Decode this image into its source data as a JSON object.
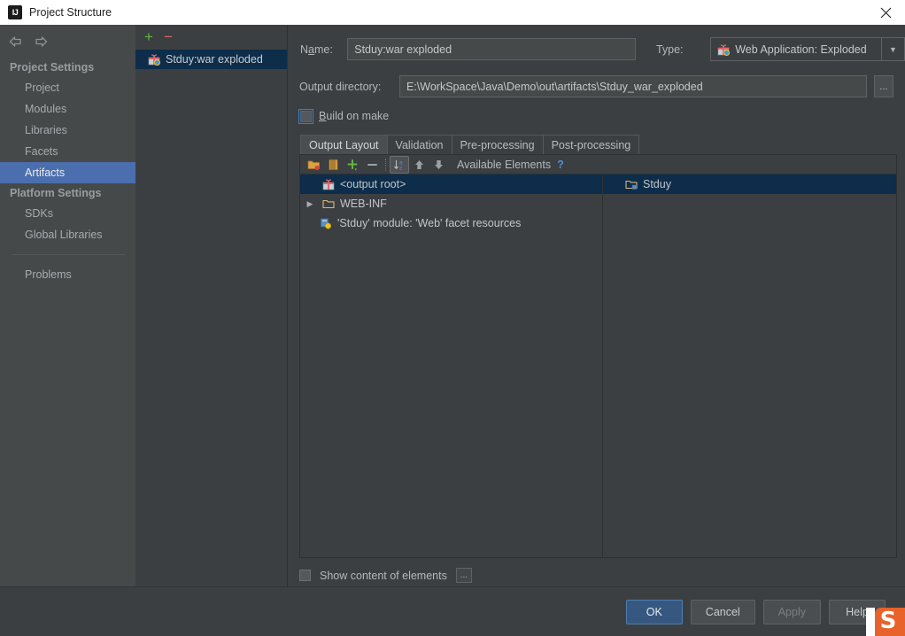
{
  "window": {
    "title": "Project Structure",
    "logo_icon": "intellij-idea-icon",
    "close_icon": "close-icon"
  },
  "sidebar": {
    "back_icon": "arrow-left-icon",
    "forward_icon": "arrow-right-icon",
    "groups": [
      {
        "label": "Project Settings",
        "items": [
          {
            "label": "Project",
            "selected": false
          },
          {
            "label": "Modules",
            "selected": false
          },
          {
            "label": "Libraries",
            "selected": false
          },
          {
            "label": "Facets",
            "selected": false
          },
          {
            "label": "Artifacts",
            "selected": true
          }
        ]
      },
      {
        "label": "Platform Settings",
        "items": [
          {
            "label": "SDKs",
            "selected": false
          },
          {
            "label": "Global Libraries",
            "selected": false
          }
        ]
      }
    ],
    "problems": {
      "label": "Problems"
    }
  },
  "artifact_list": {
    "add_label": "+",
    "remove_label": "−",
    "items": [
      {
        "label": "Stduy:war exploded",
        "icon": "artifact-icon",
        "selected": true
      }
    ]
  },
  "form": {
    "name_label": "Name:",
    "name_value": "Stduy:war exploded",
    "type_label": "Type:",
    "type_value": "Web Application: Exploded",
    "type_icon": "artifact-icon",
    "output_dir_label": "Output directory:",
    "output_dir_value": "E:\\WorkSpace\\Java\\Demo\\out\\artifacts\\Stduy_war_exploded",
    "browse_label": "...",
    "build_on_make_label": "Build on make",
    "build_on_make_checked": false
  },
  "tabs": [
    {
      "label": "Output Layout",
      "active": true
    },
    {
      "label": "Validation",
      "active": false
    },
    {
      "label": "Pre-processing",
      "active": false
    },
    {
      "label": "Post-processing",
      "active": false
    }
  ],
  "tree_toolbar": {
    "buttons": [
      {
        "name": "add-directory-icon",
        "pressed": false
      },
      {
        "name": "add-archive-icon",
        "pressed": false
      },
      {
        "name": "add-copy-icon",
        "pressed": false
      },
      {
        "name": "remove-icon",
        "pressed": false
      },
      {
        "name": "sort-alphabetically-icon",
        "pressed": true
      },
      {
        "name": "move-up-icon",
        "pressed": false
      },
      {
        "name": "move-down-icon",
        "pressed": false
      }
    ]
  },
  "available_elements": {
    "header": "Available Elements",
    "help_label": "?",
    "items": [
      {
        "label": "Stduy",
        "icon": "module-folder-icon",
        "selected": true
      }
    ]
  },
  "output_layout_tree": {
    "nodes": [
      {
        "label": "<output root>",
        "icon": "artifact-icon",
        "selected": true,
        "expandable": false,
        "indent": 0
      },
      {
        "label": "WEB-INF",
        "icon": "folder-icon",
        "selected": false,
        "expandable": true,
        "indent": 1
      },
      {
        "label": "'Stduy' module: 'Web' facet resources",
        "icon": "facet-resources-icon",
        "selected": false,
        "expandable": false,
        "indent": 2
      }
    ]
  },
  "footer": {
    "show_content_label": "Show content of elements",
    "show_content_checked": false,
    "more_label": "..."
  },
  "dialog_buttons": [
    {
      "label": "OK",
      "style": "default",
      "enabled": true
    },
    {
      "label": "Cancel",
      "style": "normal",
      "enabled": true
    },
    {
      "label": "Apply",
      "style": "normal",
      "enabled": false
    },
    {
      "label": "Help",
      "style": "normal",
      "enabled": true
    }
  ],
  "corner_badge": {
    "glyph": "S",
    "name": "sogou-input-badge"
  },
  "colors": {
    "accent_selection": "#4b6eaf",
    "tree_selection": "#0d2d4a",
    "default_button": "#365880",
    "add_green": "#62b543",
    "remove_red": "#cf6b61",
    "help_blue": "#4d94d6",
    "badge_orange": "#e8622b"
  }
}
